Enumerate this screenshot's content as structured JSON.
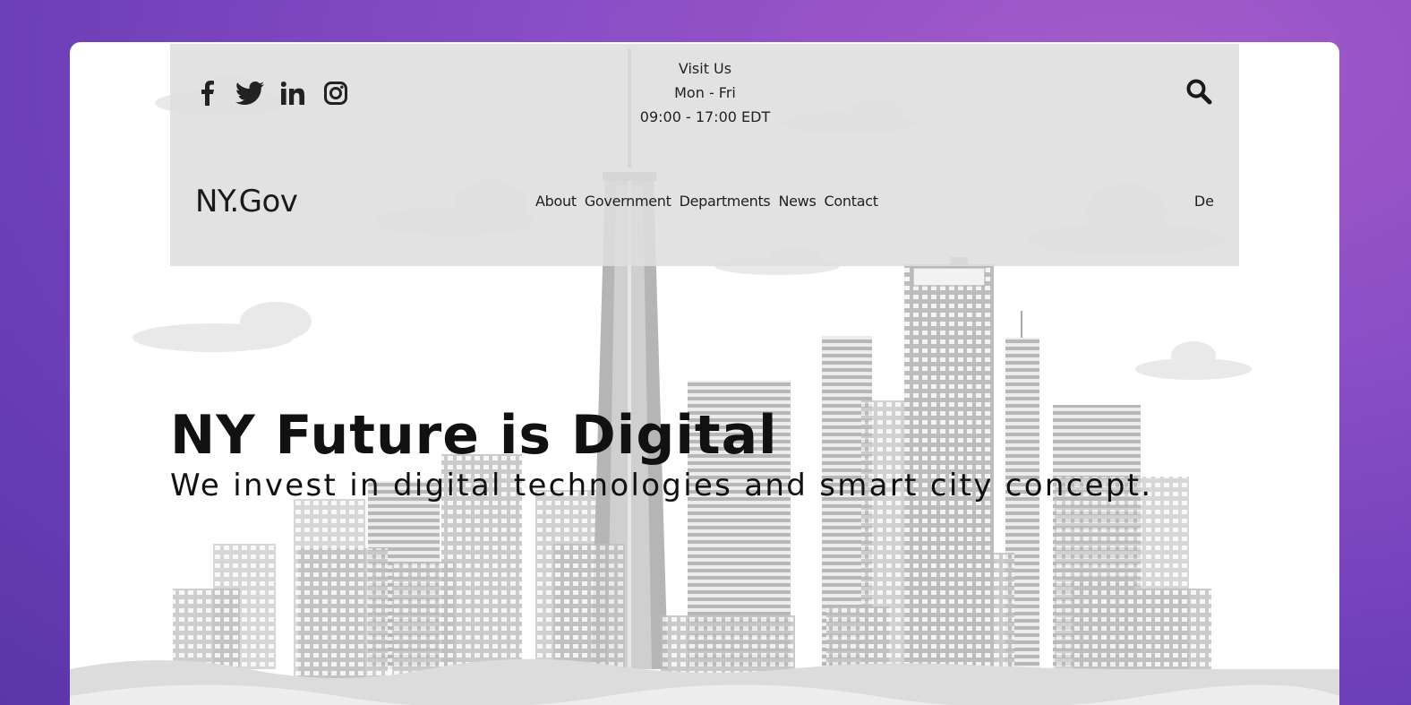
{
  "brand": "NY.Gov",
  "visit": {
    "line1": "Visit Us",
    "line2": "Mon - Fri",
    "line3": "09:00 - 17:00 EDT"
  },
  "social": [
    {
      "icon": "facebook-icon"
    },
    {
      "icon": "twitter-icon"
    },
    {
      "icon": "linkedin-icon"
    },
    {
      "icon": "instagram-icon"
    }
  ],
  "nav": [
    "About",
    "Government",
    "Departments",
    "News",
    "Contact"
  ],
  "language": "De",
  "hero": {
    "title": "NY Future is Digital",
    "subtitle": "We invest in digital technologies and smart city concept."
  },
  "colors": {
    "background_top": "#a55bc8",
    "background_bottom": "#5a37a8",
    "header_band": "#dedede",
    "text": "#111111"
  }
}
